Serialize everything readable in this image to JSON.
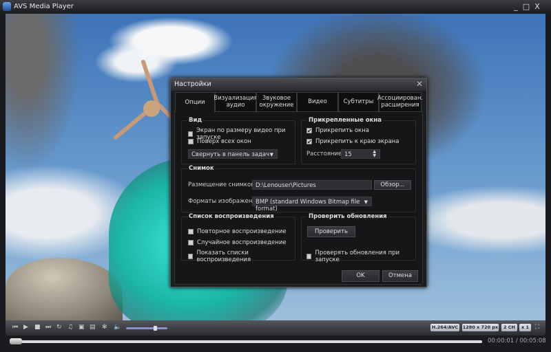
{
  "app": {
    "title": "AVS Media Player",
    "minimize": "_",
    "maximize": "□",
    "close": "X"
  },
  "dialog": {
    "title": "Настройки",
    "close": "✕",
    "tabs": [
      {
        "label": "Опции"
      },
      {
        "label": "Визуализация аудио"
      },
      {
        "label": "Звуковое окружение"
      },
      {
        "label": "Видео"
      },
      {
        "label": "Субтитры"
      },
      {
        "label": "Ассоциирован. расширения"
      }
    ],
    "view": {
      "title": "Вид",
      "fit_screen": "Экран по размеру видео при запуске",
      "fit_checked": false,
      "on_top": "Поверх всех окон",
      "on_top_checked": false,
      "minimize_select": "Свернуть в панель задач"
    },
    "docked": {
      "title": "Прикрепленные окна",
      "dock_windows": "Прикрепить окна",
      "dock_checked": true,
      "dock_edge": "Прикрепить к краю экрана",
      "edge_checked": true,
      "distance_label": "Расстояние:",
      "distance_value": "15"
    },
    "snapshot": {
      "title": "Снимок",
      "location_label": "Размещение снимков:",
      "location_value": "D:\\Lenouser\\Pictures",
      "browse": "Обзор...",
      "format_label": "Форматы изображений:",
      "format_value": "BMP (standard Windows Bitmap file format)"
    },
    "playlist": {
      "title": "Список воспроизведения",
      "repeat": "Повторное воспроизведение",
      "shuffle": "Случайное воспроизведение",
      "show_lists": "Показать списки воспроизведения"
    },
    "updates": {
      "title": "Проверить обновления",
      "check_button": "Проверить",
      "check_on_start": "Проверять обновления при запуске"
    },
    "ok": "OK",
    "cancel": "Отмена"
  },
  "player": {
    "codec": "H.264/AVC",
    "resolution": "1280 x 720 px",
    "channels": "2 CH",
    "speed": "x 1",
    "current_time": "00:00:01",
    "separator": "/",
    "total_time": "00:05:08",
    "progress_fraction": 0.003,
    "volume_fraction": 0.7
  }
}
